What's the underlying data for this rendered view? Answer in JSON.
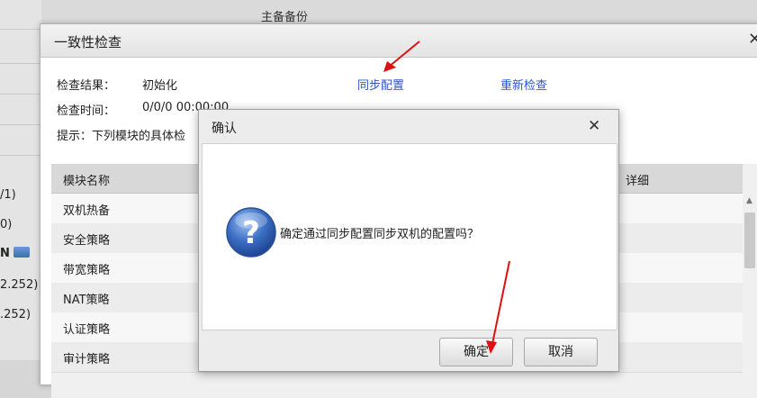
{
  "background": {
    "title": "主备备份",
    "left_fragments": [
      "/1)",
      "0)",
      "N",
      "2.252)",
      ".252)"
    ]
  },
  "main_dialog": {
    "title": "一致性检查",
    "close_icon": "close-icon",
    "result_label": "检查结果：",
    "result_value": "初始化",
    "time_label": "检查时间：",
    "time_value": "0/0/0 00:00:00",
    "hint": "提示：下列模块的具体检",
    "sync_link": "同步配置",
    "recheck_link": "重新检查",
    "table": {
      "col_module": "模块名称",
      "col_detail": "详细",
      "rows": [
        "双机热备",
        "安全策略",
        "带宽策略",
        "NAT策略",
        "认证策略",
        "审计策略"
      ]
    }
  },
  "confirm_dialog": {
    "title": "确认",
    "message": "确定通过同步配置同步双机的配置吗？",
    "icon": "question-icon",
    "ok_label": "确定",
    "cancel_label": "取消"
  },
  "colors": {
    "link": "#2f54c8",
    "annotation_arrow": "#e01010"
  }
}
